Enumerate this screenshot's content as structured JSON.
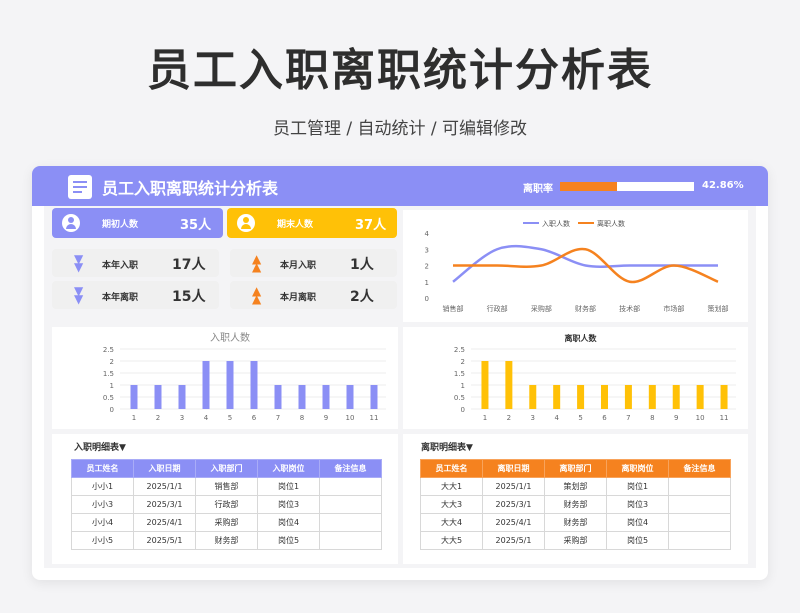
{
  "page": {
    "title": "员工入职离职统计分析表",
    "subtitle": "员工管理 / 自动统计 / 可编辑修改"
  },
  "dashboard": {
    "title": "员工入职离职统计分析表",
    "turnover_label": "离职率",
    "turnover_value": "42.86%",
    "turnover_fraction": 0.4286,
    "colors": {
      "blue": "#8b8ff5",
      "orange": "#f5821f",
      "yellow": "#ffc107"
    }
  },
  "summary": {
    "start": {
      "label": "期初人数",
      "value": "35人",
      "icon": "people-icon"
    },
    "end": {
      "label": "期末人数",
      "value": "37人",
      "icon": "people-icon"
    }
  },
  "stats": [
    {
      "label": "本年入职",
      "value": "17人",
      "icon": "double-chevron-down-icon"
    },
    {
      "label": "本月入职",
      "value": "1人",
      "icon": "double-chevron-up-icon"
    },
    {
      "label": "本年离职",
      "value": "15人",
      "icon": "double-chevron-down-icon"
    },
    {
      "label": "本月离职",
      "value": "2人",
      "icon": "double-chevron-up-icon"
    }
  ],
  "chart_data": [
    {
      "type": "line",
      "legend_position": "top",
      "categories": [
        "销售部",
        "行政部",
        "采购部",
        "财务部",
        "技术部",
        "市场部",
        "策划部"
      ],
      "series": [
        {
          "name": "入职人数",
          "values": [
            1,
            3,
            3,
            2,
            2,
            2,
            2
          ],
          "color": "#8b8ff5"
        },
        {
          "name": "离职人数",
          "values": [
            2,
            2,
            2,
            3,
            1,
            2,
            1
          ],
          "color": "#f5821f"
        }
      ],
      "ylim": [
        0,
        4
      ],
      "yticks": [
        "0",
        "1",
        "2",
        "3",
        "4"
      ],
      "grid": false
    },
    {
      "type": "bar",
      "title": "入职人数",
      "categories": [
        "1",
        "2",
        "3",
        "4",
        "5",
        "6",
        "7",
        "8",
        "9",
        "10",
        "11"
      ],
      "values": [
        1,
        1,
        1,
        2,
        2,
        2,
        1,
        1,
        1,
        1,
        1
      ],
      "ylim": [
        0,
        2.5
      ],
      "yticks": [
        "0",
        "0.5",
        "1",
        "1.5",
        "2",
        "2.5"
      ],
      "color": "#8b8ff5",
      "grid": true
    },
    {
      "type": "bar",
      "title": "离职人数",
      "categories": [
        "1",
        "2",
        "3",
        "4",
        "5",
        "6",
        "7",
        "8",
        "9",
        "10",
        "11"
      ],
      "values": [
        2,
        2,
        1,
        1,
        1,
        1,
        1,
        1,
        1,
        1,
        1
      ],
      "ylim": [
        0,
        2.5
      ],
      "yticks": [
        "0",
        "0.5",
        "1",
        "1.5",
        "2",
        "2.5"
      ],
      "color": "#ffc107",
      "grid": true
    }
  ],
  "entry_table": {
    "title": "入职明细表▼",
    "headers": [
      "员工姓名",
      "入职日期",
      "入职部门",
      "入职岗位",
      "备注信息"
    ],
    "rows": [
      [
        "小小1",
        "2025/1/1",
        "销售部",
        "岗位1",
        ""
      ],
      [
        "小小3",
        "2025/3/1",
        "行政部",
        "岗位3",
        ""
      ],
      [
        "小小4",
        "2025/4/1",
        "采购部",
        "岗位4",
        ""
      ],
      [
        "小小5",
        "2025/5/1",
        "财务部",
        "岗位5",
        ""
      ]
    ]
  },
  "leave_table": {
    "title": "离职明细表▼",
    "headers": [
      "员工姓名",
      "离职日期",
      "离职部门",
      "离职岗位",
      "备注信息"
    ],
    "rows": [
      [
        "大大1",
        "2025/1/1",
        "策划部",
        "岗位1",
        ""
      ],
      [
        "大大3",
        "2025/3/1",
        "财务部",
        "岗位3",
        ""
      ],
      [
        "大大4",
        "2025/4/1",
        "财务部",
        "岗位4",
        ""
      ],
      [
        "大大5",
        "2025/5/1",
        "采购部",
        "岗位5",
        ""
      ]
    ]
  }
}
